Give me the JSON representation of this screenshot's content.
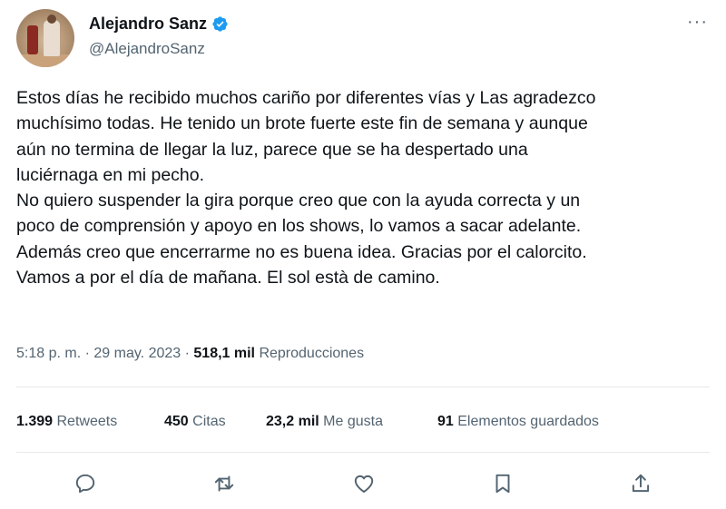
{
  "author": {
    "display_name": "Alejandro Sanz",
    "handle": "@AlejandroSanz",
    "verified": true,
    "avatar_icon": "profile-photo"
  },
  "menu": {
    "more_label": "···"
  },
  "tweet": {
    "text": "Estos días he recibido muchos cariño por diferentes vías y Las agradezco\nmuchísimo todas. He tenido un brote fuerte este fin de semana y aunque\naún no termina de llegar la luz, parece que se ha despertado una\nluciérnaga en mi pecho.\nNo quiero suspender la gira porque creo que con la ayuda correcta y un\npoco de comprensión y apoyo en los shows, lo vamos a sacar adelante.\nAdemás creo que encerrarme no es buena idea. Gracias por el calorcito.\nVamos a por el día de mañana. El sol està de camino."
  },
  "meta": {
    "time": "5:18 p. m.",
    "separator": "·",
    "date": "29 may. 2023",
    "views_count": "518,1 mil",
    "views_label": "Reproducciones"
  },
  "stats": [
    {
      "count": "1.399",
      "label": "Retweets"
    },
    {
      "count": "450",
      "label": "Citas"
    },
    {
      "count": "23,2 mil",
      "label": "Me gusta"
    },
    {
      "count": "91",
      "label": "Elementos guardados"
    }
  ],
  "actions": [
    "reply-icon",
    "retweet-icon",
    "like-icon",
    "bookmark-icon",
    "share-icon"
  ],
  "colors": {
    "text": "#0f1419",
    "secondary": "#536471",
    "verified": "#1d9bf0",
    "divider": "#e6e9ec"
  }
}
